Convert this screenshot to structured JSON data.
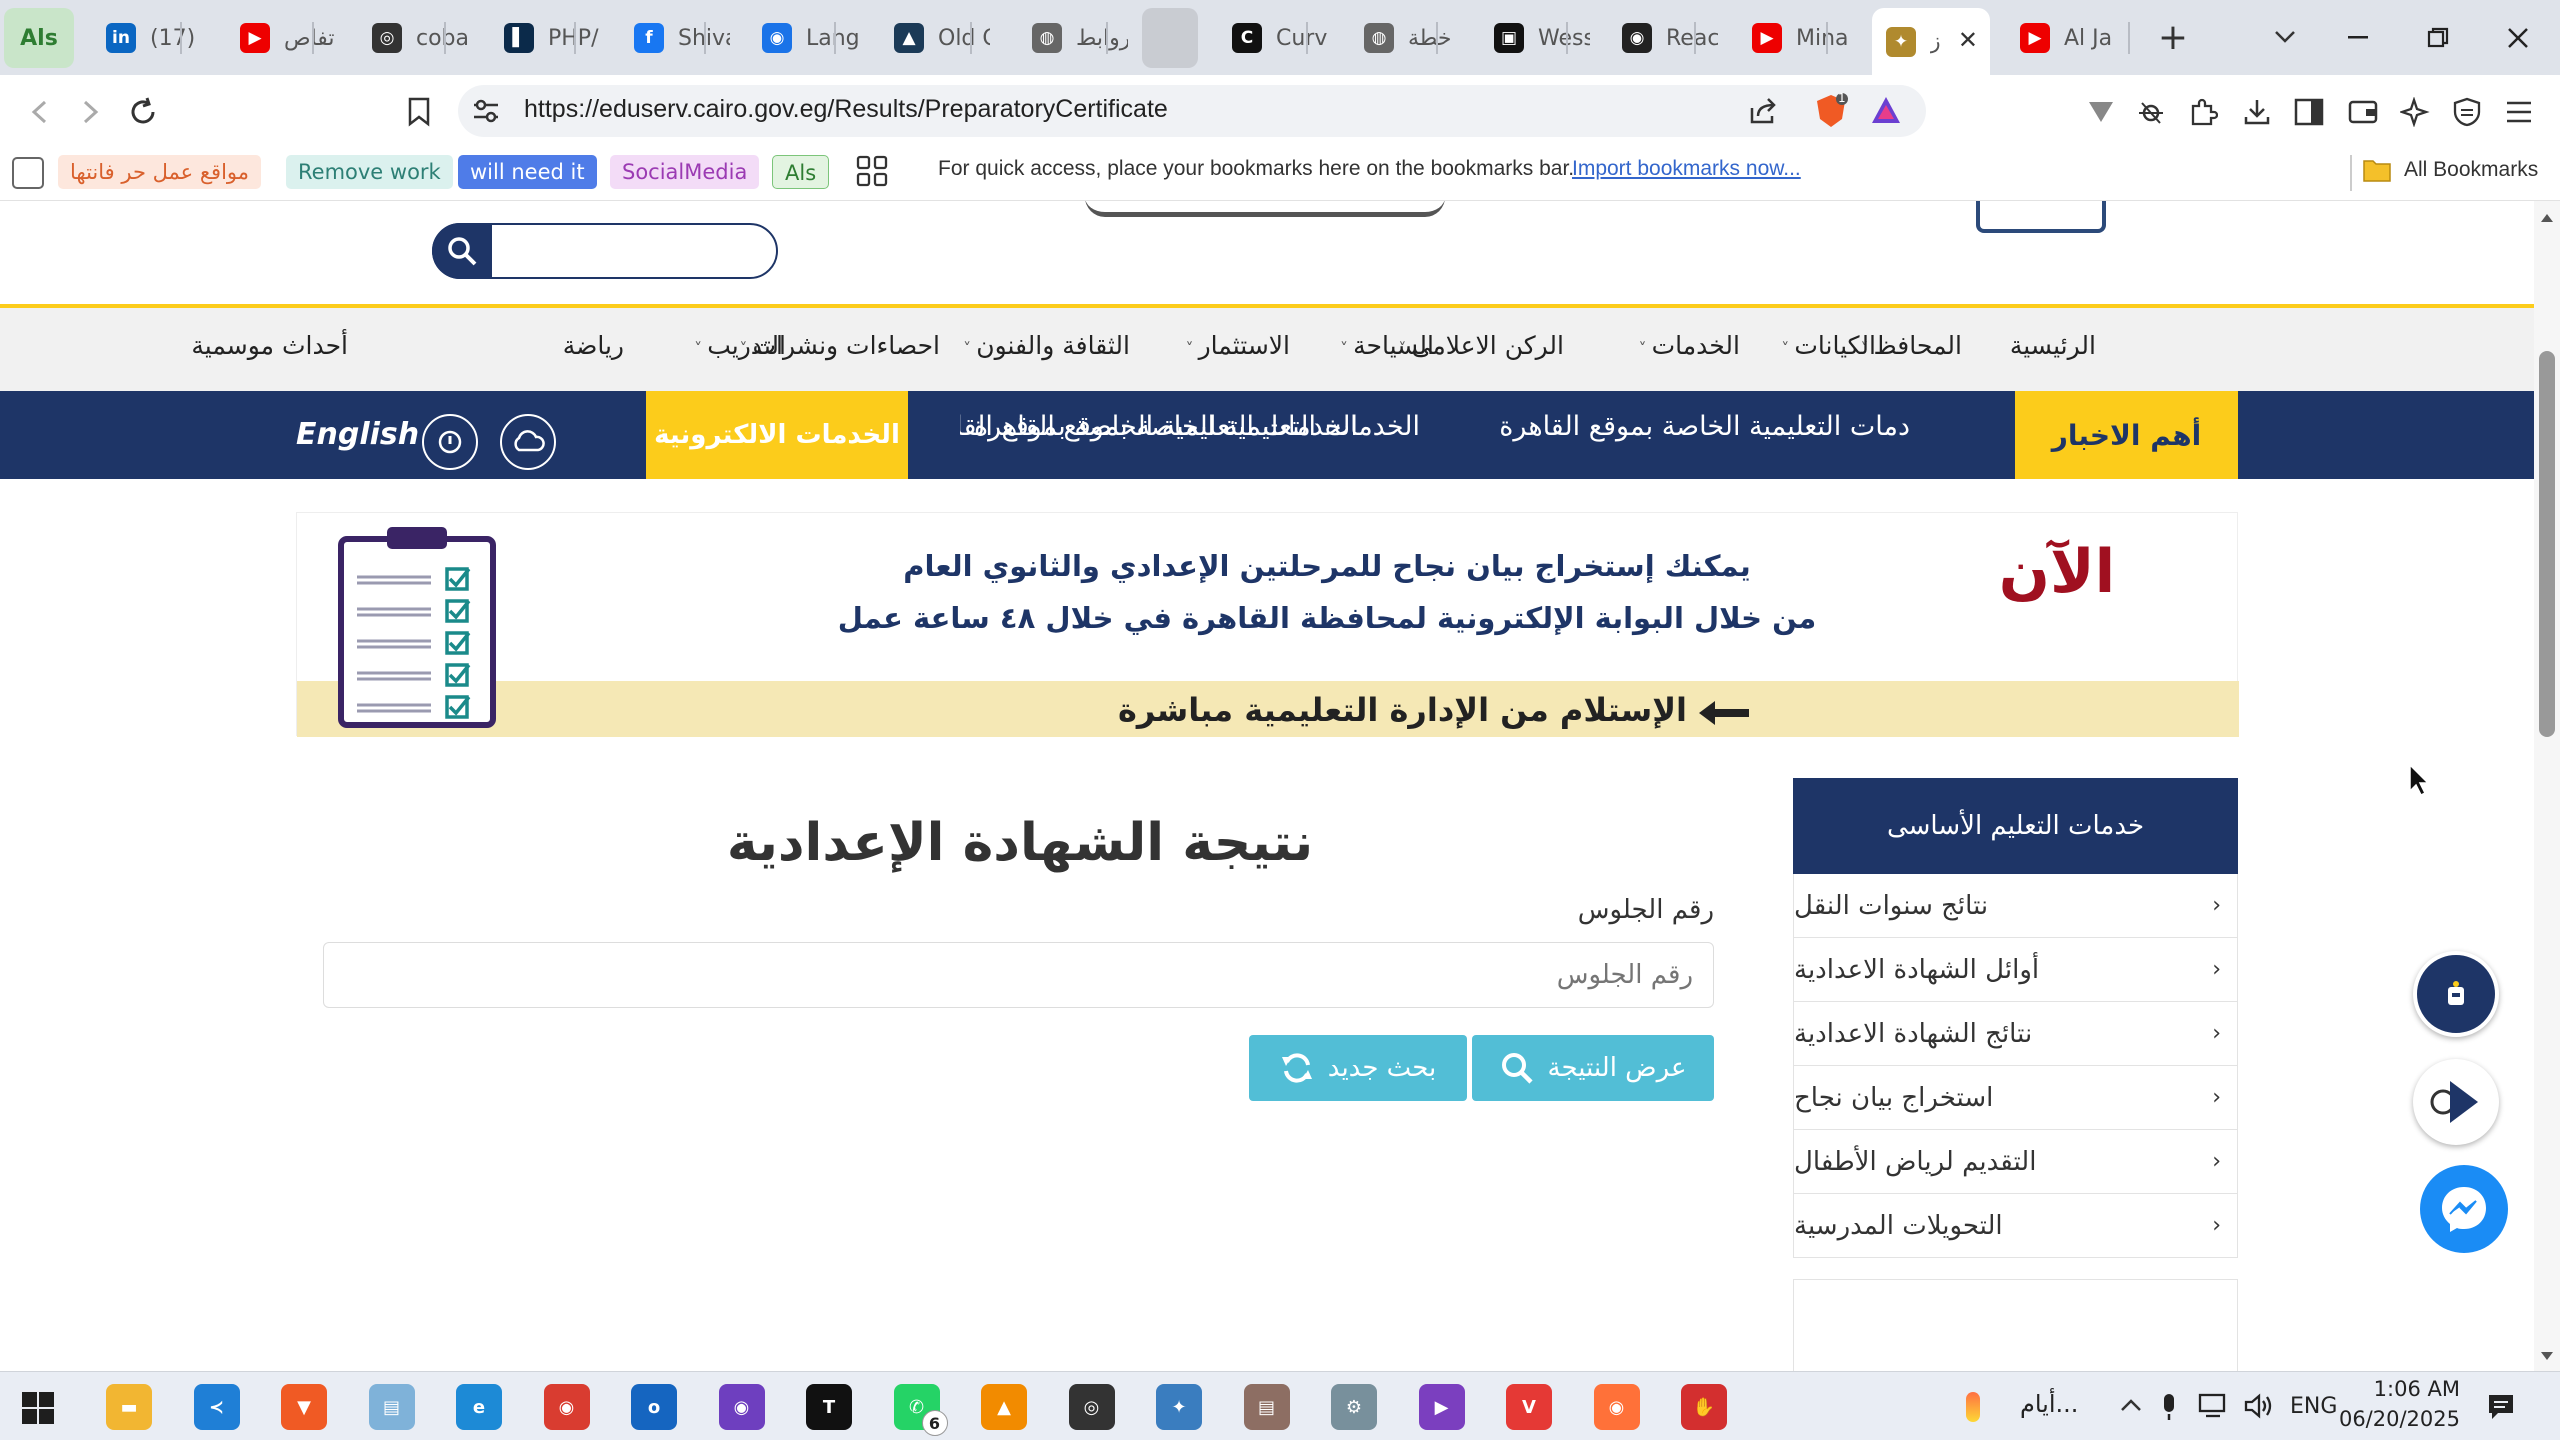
{
  "browser": {
    "tabs": [
      {
        "title": "Als",
        "fav": "Als",
        "color": "#2e7d32"
      },
      {
        "title": "(17) I",
        "fav": "in",
        "color": "#0a66c2"
      },
      {
        "title": "تفاص",
        "fav": "▶",
        "color": "#e00"
      },
      {
        "title": "coba",
        "fav": "◎",
        "color": "#333"
      },
      {
        "title": "PHP/",
        "fav": "▌",
        "color": "#0b2a4a"
      },
      {
        "title": "Shiva",
        "fav": "f",
        "color": "#1877f2"
      },
      {
        "title": "Lang",
        "fav": "◉",
        "color": "#1a73e8"
      },
      {
        "title": "Old C",
        "fav": "▲",
        "color": "#1b3a57"
      },
      {
        "title": "روابط",
        "fav": "◍",
        "color": "#666"
      },
      {
        "title": "",
        "fav": "",
        "color": "#c9ccd2"
      },
      {
        "title": "Curv",
        "fav": "C",
        "color": "#111"
      },
      {
        "title": "خطة",
        "fav": "◍",
        "color": "#666"
      },
      {
        "title": "Wess",
        "fav": "▣",
        "color": "#111"
      },
      {
        "title": "Reac",
        "fav": "◉",
        "color": "#222"
      },
      {
        "title": "Mina",
        "fav": "▶",
        "color": "#e00"
      },
      {
        "title": "ز",
        "fav": "✦",
        "color": "#b08a2e",
        "active": true
      },
      {
        "title": "Al Ja",
        "fav": "▶",
        "color": "#e00"
      }
    ],
    "url": "https://eduserv.cairo.gov.eg/Results/PreparatoryCertificate",
    "shield_badge": "1",
    "bookmarks": [
      {
        "label": "مواقع عمل حر فانتها",
        "bg": "#fde7dd",
        "fg": "#d9602c"
      },
      {
        "label": "Remove work",
        "bg": "#dbf1ee",
        "fg": "#2d7f75"
      },
      {
        "label": "will need it",
        "bg": "#4f7ce8",
        "fg": "#ffffff"
      },
      {
        "label": "SocialMedia",
        "bg": "#f3dcf7",
        "fg": "#9b3bb3"
      },
      {
        "label": "Als",
        "bg": "#e3f4e1",
        "fg": "#2e7d32"
      }
    ],
    "bookmarks_hint": "For quick access, place your bookmarks here on the bookmarks bar.",
    "import_link": "Import bookmarks now...",
    "all_bookmarks": "All Bookmarks"
  },
  "site": {
    "nav": [
      {
        "label": "الرئيسية",
        "caret": false
      },
      {
        "label": "المحافظ",
        "caret": true
      },
      {
        "label": "الكيانات",
        "caret": true
      },
      {
        "label": "الخدمات",
        "caret": true
      },
      {
        "label": "الركن الاعلامى",
        "caret": true
      },
      {
        "label": "السياحة",
        "caret": true
      },
      {
        "label": "الاستثمار",
        "caret": true
      },
      {
        "label": "الثقافة والفنون",
        "caret": true
      },
      {
        "label": "احصاءات ونشرات",
        "caret": true
      },
      {
        "label": "التدريب",
        "caret": true
      },
      {
        "label": "رياضة",
        "caret": false
      },
      {
        "label": "أحداث موسمية",
        "caret": false
      }
    ],
    "news_label": "أهم الاخبار",
    "ticker_1": "دمات التعليمية الخاصة بموقع القاهرة",
    "ticker_2": "الخدمات التعليمية الخاصة بموقع القاهرة",
    "ticker_3": "الخدمات التعليمية الخاصة بموقع القاه",
    "eservices": "الخدمات الالكترونية",
    "english": "English",
    "banner": {
      "now": "الآن",
      "line1": "يمكنك إستخراج بيان نجاح للمرحلتين الإعدادي والثانوي العام",
      "line2": "من خلال البوابة الإلكترونية لمحافظة القاهرة في خلال ٤٨ ساعة عمل",
      "line3": "الإستلام من الإدارة التعليمية مباشرة"
    },
    "sidebar": {
      "title": "خدمات التعليم الأساسى",
      "items": [
        "نتائج سنوات النقل",
        "أوائل الشهادة الاعدادية",
        "نتائج الشهادة الاعدادية",
        "استخراج بيان نجاح",
        "التقديم لرياض الأطفال",
        "التحويلات المدرسية"
      ]
    },
    "form": {
      "title": "نتيجة الشهادة الإعدادية",
      "seat_label": "رقم الجلوس",
      "seat_placeholder": "رقم الجلوس",
      "show_result": "عرض النتيجة",
      "new_search": "بحث جديد"
    }
  },
  "taskbar": {
    "apps": [
      {
        "name": "files",
        "fav": "▬",
        "color": "#f2b632"
      },
      {
        "name": "vscode",
        "fav": "≺",
        "color": "#1f7fd6"
      },
      {
        "name": "brave",
        "fav": "▼",
        "color": "#f05a24"
      },
      {
        "name": "notepad",
        "fav": "▤",
        "color": "#7fb2d9"
      },
      {
        "name": "edge",
        "fav": "e",
        "color": "#1d8ad6"
      },
      {
        "name": "chrome",
        "fav": "◉",
        "color": "#d93c30"
      },
      {
        "name": "outlook",
        "fav": "o",
        "color": "#1565c0"
      },
      {
        "name": "github",
        "fav": "◉",
        "color": "#6e3fbf"
      },
      {
        "name": "t-app",
        "fav": "T",
        "color": "#111"
      },
      {
        "name": "whatsapp",
        "fav": "✆",
        "color": "#25d366",
        "badge": "6"
      },
      {
        "name": "vlc",
        "fav": "▲",
        "color": "#f28b00"
      },
      {
        "name": "obs",
        "fav": "◎",
        "color": "#333"
      },
      {
        "name": "davinci",
        "fav": "✦",
        "color": "#3a7dbf"
      },
      {
        "name": "books",
        "fav": "▤",
        "color": "#8d6e63"
      },
      {
        "name": "settings",
        "fav": "⚙",
        "color": "#78909c"
      },
      {
        "name": "visual-studio",
        "fav": "▶",
        "color": "#7b3fbf"
      },
      {
        "name": "vivaldi",
        "fav": "V",
        "color": "#e53935"
      },
      {
        "name": "firefox",
        "fav": "◉",
        "color": "#ff7139"
      },
      {
        "name": "red-app",
        "fav": "✋",
        "color": "#d32f2f"
      }
    ],
    "weather": "أيام...",
    "lang": "ENG",
    "time": "1:06 AM",
    "date": "06/20/2025"
  },
  "colors": {
    "navy": "#1e3567",
    "yellow": "#fccc1b",
    "teal": "#52bed6",
    "maroon": "#a01020"
  }
}
